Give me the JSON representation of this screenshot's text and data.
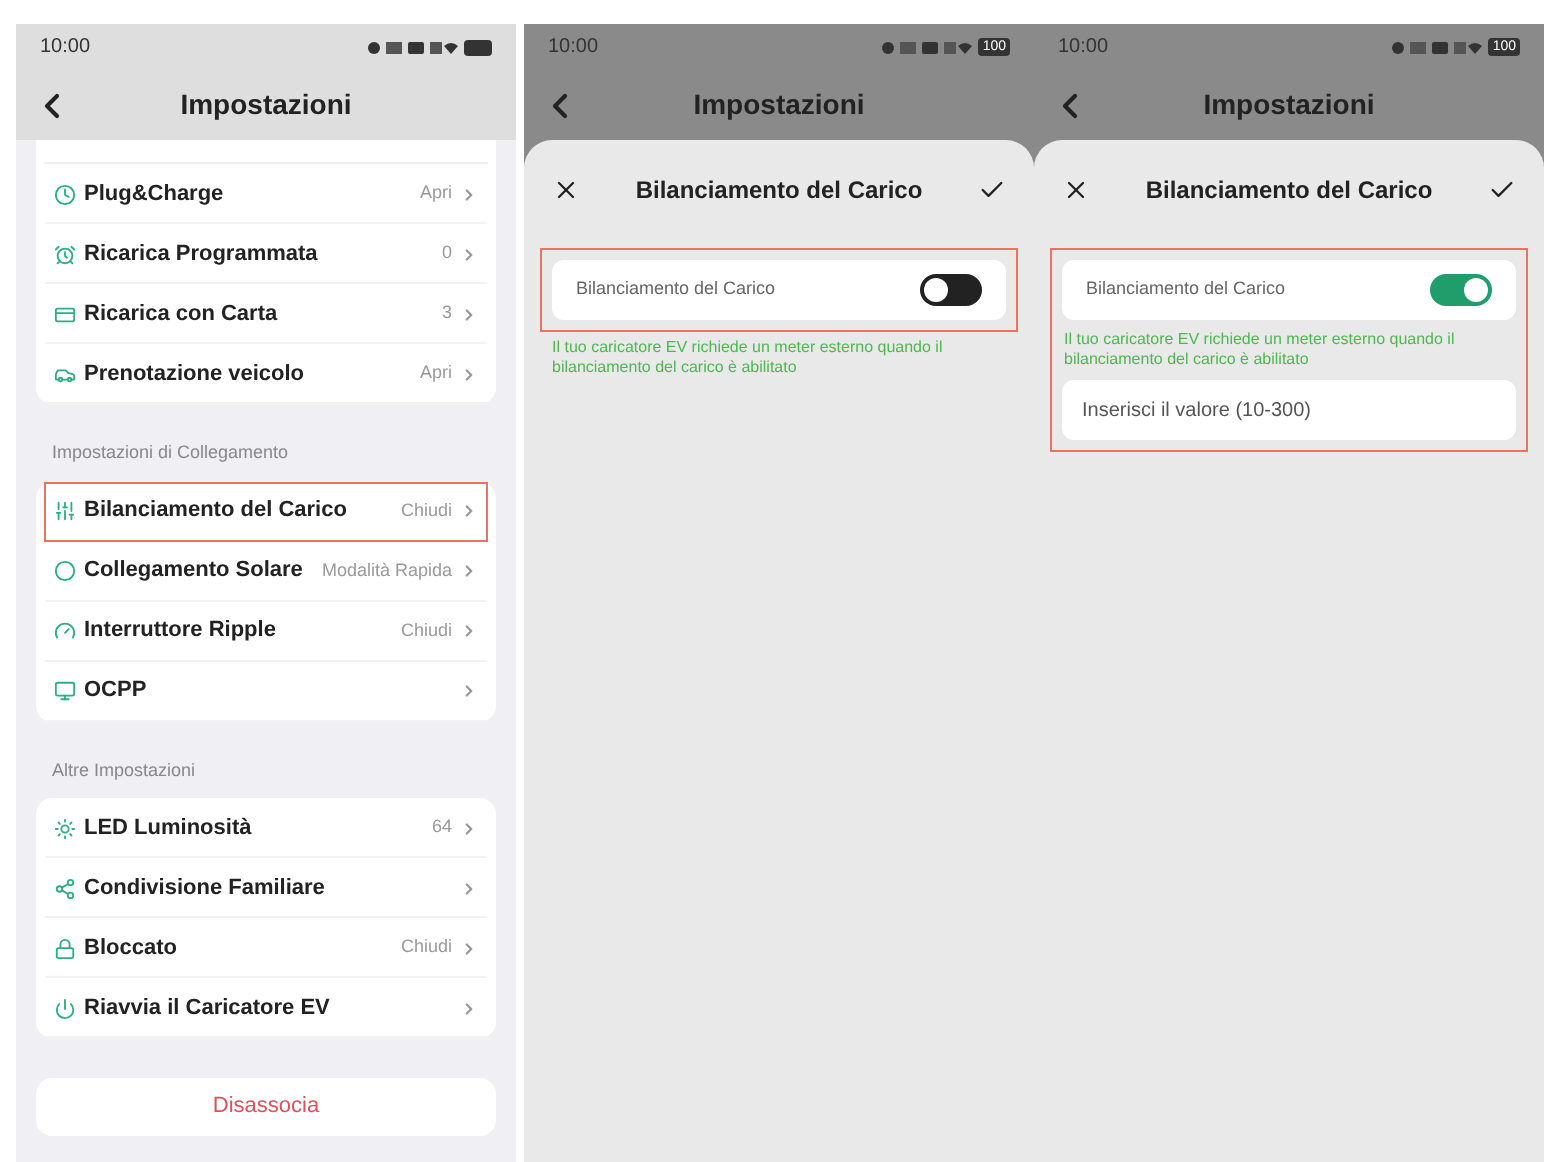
{
  "screens": [
    {
      "kind": "settings",
      "status_bar": {
        "time": "10:00"
      },
      "header": {
        "title": "Impostazioni"
      },
      "sections": [
        {
          "items": [
            {
              "label": "Plug&Charge",
              "value": "Apri",
              "highlighted": false
            },
            {
              "label": "Ricarica Programmata",
              "value": "0",
              "highlighted": false
            },
            {
              "label": "Ricarica con Carta",
              "value": "3",
              "highlighted": false
            },
            {
              "label": "Prenotazione veicolo",
              "value": "Apri",
              "highlighted": false
            }
          ]
        },
        {
          "label": "Impostazioni di Collegamento",
          "items": [
            {
              "label": "Bilanciamento del Carico",
              "value": "Chiudi",
              "highlighted": true
            },
            {
              "label": "Collegamento Solare",
              "value": "Modalità Rapida",
              "highlighted": false
            },
            {
              "label": "Interruttore Ripple",
              "value": "Chiudi",
              "highlighted": false
            },
            {
              "label": "OCPP",
              "highlighted": false
            }
          ]
        },
        {
          "label": "Altre Impostazioni",
          "items": [
            {
              "label": "LED Luminosità",
              "value": "64",
              "highlighted": false
            },
            {
              "label": "Condivisione Familiare",
              "highlighted": false
            },
            {
              "label": "Bloccato",
              "value": "Chiudi",
              "highlighted": false
            },
            {
              "label": "Riavvia il Caricatore EV",
              "highlighted": false
            }
          ]
        }
      ],
      "unpair_button": "Disassocia"
    },
    {
      "kind": "sheet",
      "status_bar": {
        "time": "10:00",
        "battery": "100"
      },
      "header": {
        "title": "Impostazioni"
      },
      "sheet": {
        "title": "Bilanciamento del Carico",
        "highlighted": true,
        "toggle": {
          "label": "Bilanciamento del Carico",
          "on": false
        },
        "helper": "Il tuo caricatore EV richiede un meter esterno quando il bilanciamento del carico è abilitato"
      }
    },
    {
      "kind": "sheet",
      "status_bar": {
        "time": "10:00",
        "battery": "100"
      },
      "header": {
        "title": "Impostazioni"
      },
      "sheet": {
        "title": "Bilanciamento del Carico",
        "highlighted": true,
        "toggle": {
          "label": "Bilanciamento del Carico",
          "on": true
        },
        "helper": "Il tuo caricatore EV richiede un meter esterno quando il bilanciamento del carico è abilitato",
        "input": {
          "placeholder": "Inserisci il valore (10-300)"
        }
      }
    }
  ]
}
